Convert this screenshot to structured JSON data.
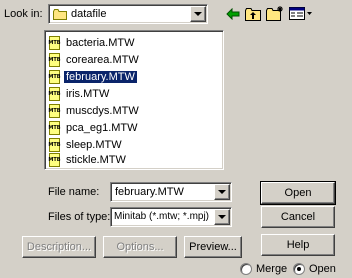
{
  "look_in": {
    "label": "Look in:",
    "value": "datafile"
  },
  "files": [
    {
      "name": "bacteria.MTW",
      "selected": false
    },
    {
      "name": "corearea.MTW",
      "selected": false
    },
    {
      "name": "february.MTW",
      "selected": true
    },
    {
      "name": "iris.MTW",
      "selected": false
    },
    {
      "name": "muscdys.MTW",
      "selected": false
    },
    {
      "name": "pca_eg1.MTW",
      "selected": false
    },
    {
      "name": "sleep.MTW",
      "selected": false
    },
    {
      "name": "stickle.MTW",
      "selected": false
    }
  ],
  "file_icon_text": "MTB",
  "file_name": {
    "label": "File name:",
    "value": "february.MTW"
  },
  "file_type": {
    "label": "Files of type:",
    "value": "Minitab (*.mtw; *.mpj)"
  },
  "buttons": {
    "open": "Open",
    "cancel": "Cancel",
    "help": "Help",
    "description": "Description...",
    "options": "Options...",
    "preview": "Preview..."
  },
  "mode": {
    "merge_label": "Merge",
    "open_label": "Open",
    "selected": "open"
  },
  "colors": {
    "background": "#d4d0c8",
    "selection": "#0a246a",
    "folder": "#ffe680",
    "back_arrow": "#00a000"
  },
  "icons": [
    "folder-icon",
    "back-arrow-icon",
    "up-folder-icon",
    "new-folder-icon",
    "view-menu-icon"
  ]
}
